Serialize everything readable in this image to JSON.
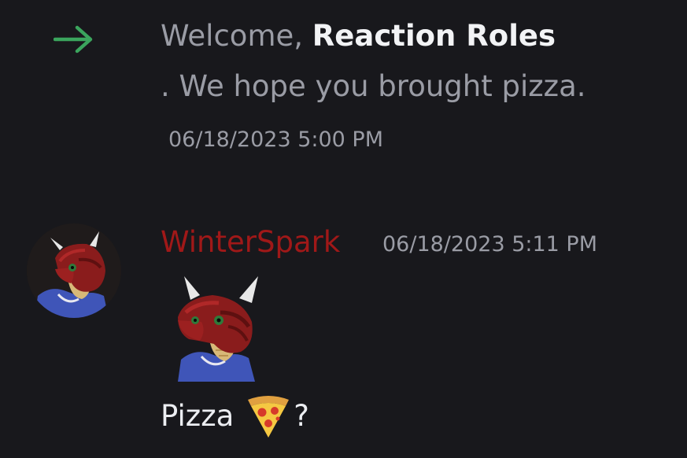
{
  "join_message": {
    "prefix": "Welcome, ",
    "member_name": "Reaction Roles",
    "suffix": ". We hope you brought pizza.",
    "timestamp": "06/18/2023 5:00 PM",
    "arrow_color": "#3ba55d"
  },
  "message": {
    "author": "WinterSpark",
    "author_color": "#a01818",
    "timestamp": "06/18/2023 5:11 PM",
    "text_before": "Pizza",
    "emoji": "pizza-emoji",
    "text_after": "?",
    "avatar_icon": "red-dragon-avatar",
    "sticker_icon": "red-dragon-sticker"
  }
}
